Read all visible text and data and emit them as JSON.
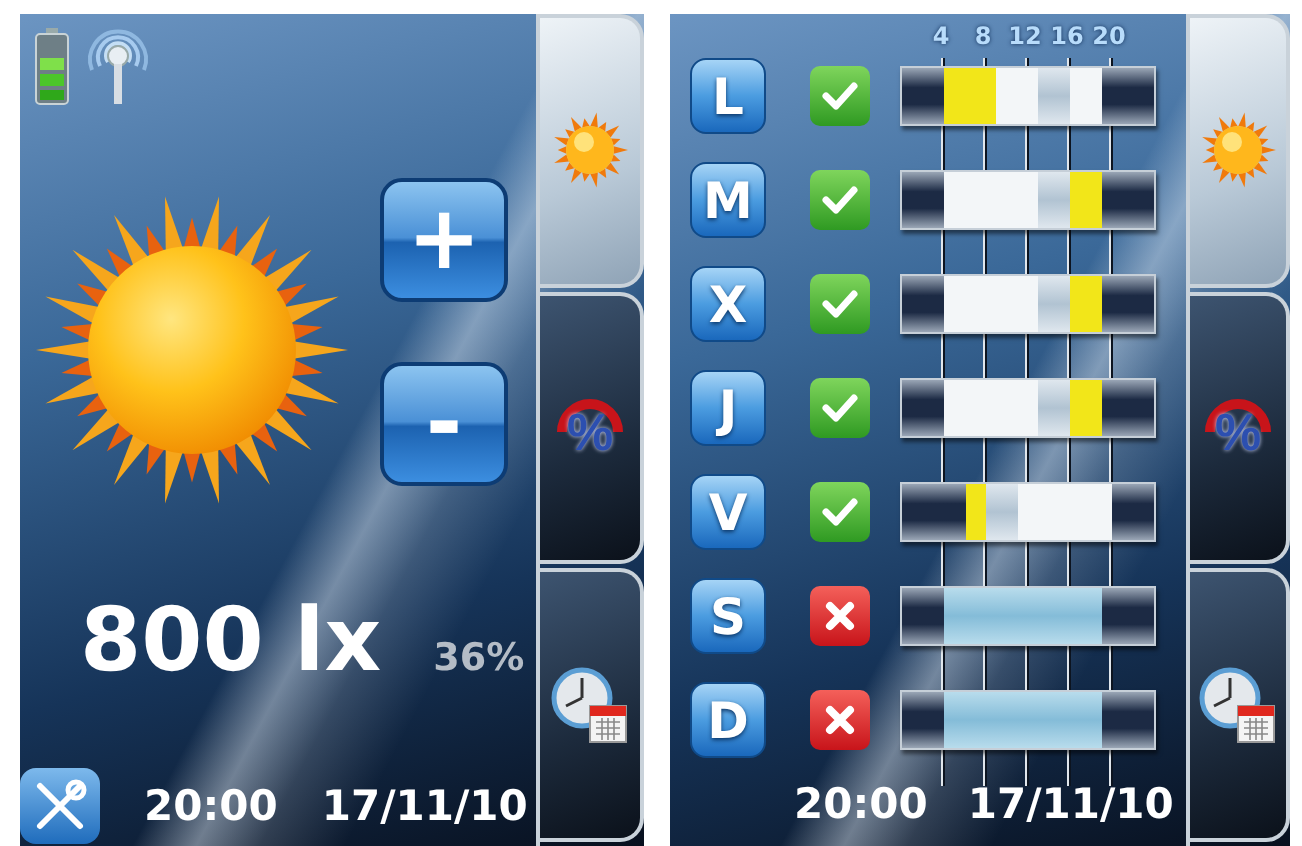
{
  "screens": [
    {
      "kind": "level",
      "plus_button": "+",
      "minus_button": "-",
      "illuminance": "800 lx",
      "percent": "36%",
      "time": "20:00",
      "date": "17/11/10",
      "tabs": [
        {
          "kind": "sun",
          "selected": true
        },
        {
          "kind": "percent",
          "label": "%",
          "selected": false
        },
        {
          "kind": "clock",
          "selected": false
        }
      ]
    },
    {
      "kind": "schedule",
      "scale": [
        "4",
        "8",
        "12",
        "16",
        "20"
      ],
      "time": "20:00",
      "date": "17/11/10",
      "days": [
        {
          "label": "L",
          "kind": "tick",
          "slots": [
            {
              "kind": "night"
            },
            {
              "kind": "night"
            },
            {
              "kind": "night"
            },
            {
              "kind": "night"
            },
            {
              "kind": "on"
            },
            {
              "kind": "on"
            },
            {
              "kind": "on"
            },
            {
              "kind": "on"
            },
            {
              "kind": "on"
            },
            {
              "kind": "off"
            },
            {
              "kind": "off"
            },
            {
              "kind": "off"
            },
            {
              "kind": "off"
            },
            {
              "kind": "dim"
            },
            {
              "kind": "dim"
            },
            {
              "kind": "dim"
            },
            {
              "kind": "off"
            },
            {
              "kind": "off"
            },
            {
              "kind": "off"
            },
            {
              "kind": "night"
            },
            {
              "kind": "night"
            },
            {
              "kind": "night"
            },
            {
              "kind": "night"
            },
            {
              "kind": "night"
            }
          ]
        },
        {
          "label": "M",
          "kind": "tick",
          "slots": [
            {
              "kind": "night"
            },
            {
              "kind": "night"
            },
            {
              "kind": "night"
            },
            {
              "kind": "night"
            },
            {
              "kind": "off"
            },
            {
              "kind": "off"
            },
            {
              "kind": "off"
            },
            {
              "kind": "off"
            },
            {
              "kind": "off"
            },
            {
              "kind": "off"
            },
            {
              "kind": "off"
            },
            {
              "kind": "off"
            },
            {
              "kind": "off"
            },
            {
              "kind": "dim"
            },
            {
              "kind": "dim"
            },
            {
              "kind": "dim"
            },
            {
              "kind": "on"
            },
            {
              "kind": "on"
            },
            {
              "kind": "on"
            },
            {
              "kind": "night"
            },
            {
              "kind": "night"
            },
            {
              "kind": "night"
            },
            {
              "kind": "night"
            },
            {
              "kind": "night"
            }
          ]
        },
        {
          "label": "X",
          "kind": "tick",
          "slots": [
            {
              "kind": "night"
            },
            {
              "kind": "night"
            },
            {
              "kind": "night"
            },
            {
              "kind": "night"
            },
            {
              "kind": "off"
            },
            {
              "kind": "off"
            },
            {
              "kind": "off"
            },
            {
              "kind": "off"
            },
            {
              "kind": "off"
            },
            {
              "kind": "off"
            },
            {
              "kind": "off"
            },
            {
              "kind": "off"
            },
            {
              "kind": "off"
            },
            {
              "kind": "dim"
            },
            {
              "kind": "dim"
            },
            {
              "kind": "dim"
            },
            {
              "kind": "on"
            },
            {
              "kind": "on"
            },
            {
              "kind": "on"
            },
            {
              "kind": "night"
            },
            {
              "kind": "night"
            },
            {
              "kind": "night"
            },
            {
              "kind": "night"
            },
            {
              "kind": "night"
            }
          ]
        },
        {
          "label": "J",
          "kind": "tick",
          "slots": [
            {
              "kind": "night"
            },
            {
              "kind": "night"
            },
            {
              "kind": "night"
            },
            {
              "kind": "night"
            },
            {
              "kind": "off"
            },
            {
              "kind": "off"
            },
            {
              "kind": "off"
            },
            {
              "kind": "off"
            },
            {
              "kind": "off"
            },
            {
              "kind": "off"
            },
            {
              "kind": "off"
            },
            {
              "kind": "off"
            },
            {
              "kind": "off"
            },
            {
              "kind": "dim"
            },
            {
              "kind": "dim"
            },
            {
              "kind": "dim"
            },
            {
              "kind": "on"
            },
            {
              "kind": "on"
            },
            {
              "kind": "on"
            },
            {
              "kind": "night"
            },
            {
              "kind": "night"
            },
            {
              "kind": "night"
            },
            {
              "kind": "night"
            },
            {
              "kind": "night"
            }
          ]
        },
        {
          "label": "V",
          "kind": "tick",
          "slots": [
            {
              "kind": "night"
            },
            {
              "kind": "night"
            },
            {
              "kind": "night"
            },
            {
              "kind": "night"
            },
            {
              "kind": "night"
            },
            {
              "kind": "night"
            },
            {
              "kind": "on"
            },
            {
              "kind": "on"
            },
            {
              "kind": "dim"
            },
            {
              "kind": "dim"
            },
            {
              "kind": "dim"
            },
            {
              "kind": "off"
            },
            {
              "kind": "off"
            },
            {
              "kind": "off"
            },
            {
              "kind": "off"
            },
            {
              "kind": "off"
            },
            {
              "kind": "off"
            },
            {
              "kind": "off"
            },
            {
              "kind": "off"
            },
            {
              "kind": "off"
            },
            {
              "kind": "night"
            },
            {
              "kind": "night"
            },
            {
              "kind": "night"
            },
            {
              "kind": "night"
            }
          ]
        },
        {
          "label": "S",
          "kind": "cross",
          "slots": [
            {
              "kind": "night"
            },
            {
              "kind": "night"
            },
            {
              "kind": "night"
            },
            {
              "kind": "night"
            },
            {
              "kind": "inactive"
            },
            {
              "kind": "inactive"
            },
            {
              "kind": "inactive"
            },
            {
              "kind": "inactive"
            },
            {
              "kind": "inactive"
            },
            {
              "kind": "inactive"
            },
            {
              "kind": "inactive"
            },
            {
              "kind": "inactive"
            },
            {
              "kind": "inactive"
            },
            {
              "kind": "inactive"
            },
            {
              "kind": "inactive"
            },
            {
              "kind": "inactive"
            },
            {
              "kind": "inactive"
            },
            {
              "kind": "inactive"
            },
            {
              "kind": "inactive"
            },
            {
              "kind": "night"
            },
            {
              "kind": "night"
            },
            {
              "kind": "night"
            },
            {
              "kind": "night"
            },
            {
              "kind": "night"
            }
          ]
        },
        {
          "label": "D",
          "kind": "cross",
          "slots": [
            {
              "kind": "night"
            },
            {
              "kind": "night"
            },
            {
              "kind": "night"
            },
            {
              "kind": "night"
            },
            {
              "kind": "inactive"
            },
            {
              "kind": "inactive"
            },
            {
              "kind": "inactive"
            },
            {
              "kind": "inactive"
            },
            {
              "kind": "inactive"
            },
            {
              "kind": "inactive"
            },
            {
              "kind": "inactive"
            },
            {
              "kind": "inactive"
            },
            {
              "kind": "inactive"
            },
            {
              "kind": "inactive"
            },
            {
              "kind": "inactive"
            },
            {
              "kind": "inactive"
            },
            {
              "kind": "inactive"
            },
            {
              "kind": "inactive"
            },
            {
              "kind": "inactive"
            },
            {
              "kind": "night"
            },
            {
              "kind": "night"
            },
            {
              "kind": "night"
            },
            {
              "kind": "night"
            },
            {
              "kind": "night"
            }
          ]
        }
      ],
      "tabs": [
        {
          "kind": "sun",
          "selected": true
        },
        {
          "kind": "percent",
          "label": "%",
          "selected": false
        },
        {
          "kind": "clock",
          "selected": false
        }
      ]
    }
  ]
}
